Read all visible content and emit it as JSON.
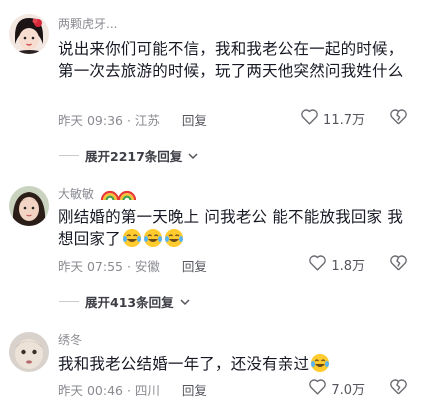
{
  "comments": [
    {
      "username": "两颗虎牙...",
      "content": "说出来你们可能不信，我和我老公在一起的时候，第一次去旅游的时候，玩了两天他突然问我姓什么",
      "time_location": "昨天 09:36 · 江苏",
      "reply_label": "回复",
      "likes": "11.7万",
      "expand_label": "展开2217条回复",
      "emoji_count": 0
    },
    {
      "username": "大敏敏",
      "content": "刚结婚的第一天晚上 问我老公 能不能放我回家 我想回家了",
      "time_location": "昨天 07:55 · 安徽",
      "reply_label": "回复",
      "likes": "1.8万",
      "expand_label": "展开413条回复",
      "emoji_count": 3
    },
    {
      "username": "绣冬",
      "content": "我和我老公结婚一年了，还没有亲过",
      "time_location": "昨天 00:46 · 四川",
      "reply_label": "回复",
      "likes": "7.0万",
      "emoji_count": 1
    }
  ],
  "icons": {
    "like": "heart-outline-icon",
    "dislike": "broken-heart-icon",
    "expand": "chevron-down-icon",
    "emoji": "tears-of-joy-emoji",
    "badge": "rainbow-icon"
  },
  "colors": {
    "text_primary": "#161823",
    "text_secondary": "#8a8b91",
    "text_action": "#54555c"
  }
}
